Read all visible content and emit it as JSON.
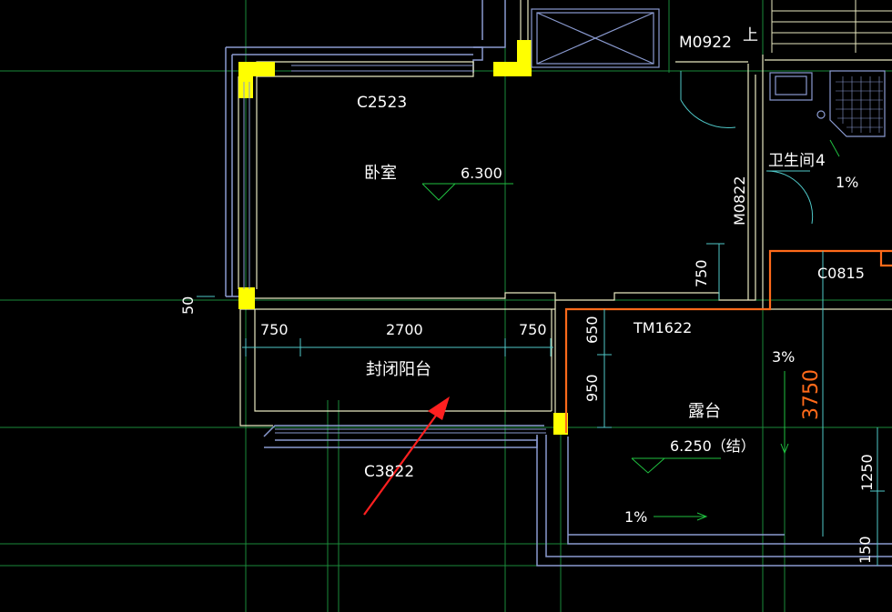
{
  "drawing": {
    "labels": {
      "window_top": "C2523",
      "bedroom": "卧室",
      "bedroom_level": "6.300",
      "closed_balcony": "封闭阳台",
      "window_bottom": "C3822",
      "door_top": "M0922",
      "door_side": "M0822",
      "stair_mark": "上",
      "bathroom": "卫生间",
      "bathroom_no": "4",
      "bathroom_slope": "1%",
      "window_right": "C0815",
      "sliding_door": "TM1622",
      "terrace": "露台",
      "terrace_level": "6.250（结）",
      "terrace_slope_top": "3%",
      "terrace_slope_bottom": "1%"
    },
    "dimensions": {
      "d750_left": "750",
      "d2700": "2700",
      "d750_right": "750",
      "d50": "50",
      "d650": "650",
      "d950": "950",
      "d750_vertical": "750",
      "d3750": "3750",
      "d1250": "1250",
      "d150": "150"
    },
    "colors": {
      "background": "#000000",
      "wall": "#ffff00",
      "outline": "#8a9ad0",
      "axis": "#1a8a3a",
      "dimension": "#4fc8c8",
      "terrace_edge": "#ff6a1a",
      "annotation_arrow": "#ff2020"
    }
  }
}
